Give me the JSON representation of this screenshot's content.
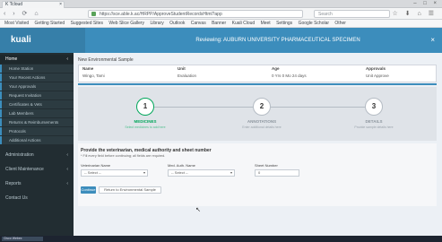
{
  "browser": {
    "tab_title": "K Tcloud",
    "tab_close": "×",
    "window_controls": "– □ ×",
    "nav_buttons": "‹ › ⟳ ⌂",
    "url": "https://sce.able.k.ac/HRPP/ApproveStudentRecordsHtml?app",
    "search_placeholder": "Search",
    "toolbar_icons": "☆ ⬇ ⌂ ☰",
    "bookmarks": [
      "Most Visited",
      "Getting Started",
      "Suggested Sites",
      "Web Slice Gallery",
      "Library",
      "Outlook",
      "Canvas",
      "Banner",
      "Kuali Cloud",
      "Meet",
      "Settings",
      "Google Scholar",
      "Other"
    ]
  },
  "header": {
    "logo": "kuali",
    "title": "Reviewing: AUBURN UNIVERSITY PHARMACEUTICAL SPECIMEN",
    "close": "×"
  },
  "sidebar": {
    "head": "Home",
    "head_chevron": "‹",
    "items": [
      "Home Station",
      "Your Recent Actions",
      "Your Approvals",
      "Request Invitation",
      "Certificates & Vets",
      "Lab Members",
      "Returns & Reimbursements",
      "Protocols",
      "Additional Actions"
    ],
    "groups": [
      {
        "label": "Administration",
        "chevron": "‹"
      },
      {
        "label": "Client Maintenance",
        "chevron": "‹"
      },
      {
        "label": "Reports",
        "chevron": "‹"
      },
      {
        "label": "Contact Us",
        "chevron": ""
      }
    ]
  },
  "main": {
    "breadcrumb": "New Environmental Sample",
    "table": {
      "headers": [
        "Name",
        "Unit",
        "Age",
        "Approvals"
      ],
      "values": [
        "Wingo, Tami",
        "Evaluation",
        "0 Yrs 0 Mo 24 days",
        "Unit Approve"
      ]
    },
    "steps": [
      {
        "number": "1",
        "title": "MEDICINES",
        "subtitle": "Select medicines to add here",
        "active": true
      },
      {
        "number": "2",
        "title": "ANNOTATIONS",
        "subtitle": "Enter additional details here",
        "active": false
      },
      {
        "number": "3",
        "title": "DETAILS",
        "subtitle": "Provide sample details here",
        "active": false
      }
    ],
    "form": {
      "title": "Provide the veterinarian, medical authority and sheet number",
      "hint": "* Fill every field before continuing; all fields are required.",
      "vet_label": "Veterinarian Name",
      "vet_value": "-- Select --",
      "authority_label": "Med. Auth. Name",
      "authority_value": "-- Select --",
      "sheet_label": "Sheet Number",
      "sheet_value": "0",
      "continue_button": "Continue",
      "return_button": "Return to Environmental Sample",
      "dropdown_glyph": "▾"
    }
  },
  "taskbar": {
    "item": "Cisco Webex"
  }
}
